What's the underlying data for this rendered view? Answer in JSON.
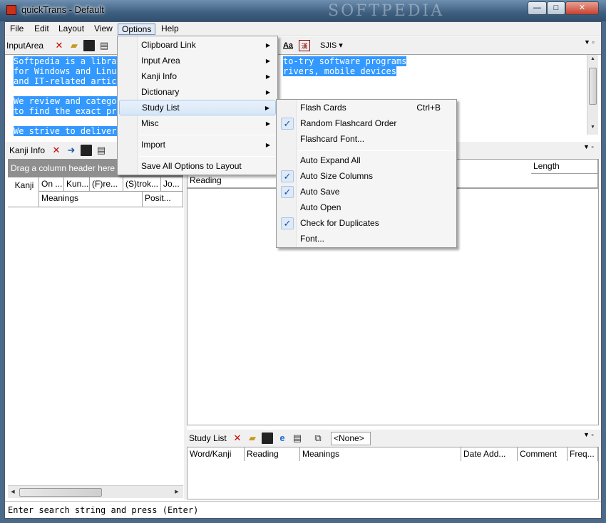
{
  "window": {
    "title": "quickTrans - Default",
    "watermark": "SOFTPEDIA",
    "buttons": {
      "minimize": "—",
      "maximize": "□",
      "close": "✕"
    }
  },
  "menubar": {
    "items": [
      "File",
      "Edit",
      "Layout",
      "View",
      "Options",
      "Help"
    ],
    "active": "Options"
  },
  "input_area": {
    "title": "InputArea",
    "encoding": "SJIS",
    "lines": [
      "Softpedia is a library of over 400,000 free and free-to-try software programs",
      "for Windows and Linux, games, Mac software, Windows drivers, mobile devices",
      "and IT-related articles.",
      "",
      "We review and categorize these products in order to allow the visitor/user",
      "to find the exact product they and their system needs.",
      "",
      "We strive to deliver only the best products to the visitor/user."
    ],
    "visible_fragments": {
      "line1_left": "Softpedia is a librar",
      "line1_right": "to-try software programs",
      "line2_left": "for Windows and Linux",
      "line2_right": "rivers, mobile devices",
      "line3_left": "and IT-related artic",
      "line5_left": "We review and categor",
      "line6_left": "to find the exact pro",
      "line8_left": "We strive to deliver "
    }
  },
  "kanji_info": {
    "title": "Kanji Info",
    "group_hint": "Drag a column header here",
    "columns_row1": [
      "Kanji",
      "On ...",
      "Kun...",
      "(F)re...",
      "(S)trok...",
      "Jo..."
    ],
    "columns_row2": [
      "Meanings",
      "Posit..."
    ]
  },
  "dictionary": {
    "columns": [
      "Length"
    ],
    "sub_columns": [
      "Reading"
    ]
  },
  "study_list": {
    "title": "Study List",
    "selector": "<None>",
    "columns": [
      "Word/Kanji",
      "Reading",
      "Meanings",
      "Date Add...",
      "Comment",
      "Freq..."
    ]
  },
  "status": {
    "prompt": "Enter search string and press (Enter)"
  },
  "options_menu": {
    "items": [
      {
        "label": "Clipboard Link",
        "submenu": true
      },
      {
        "label": "Input Area",
        "submenu": true
      },
      {
        "label": "Kanji Info",
        "submenu": true
      },
      {
        "label": "Dictionary",
        "submenu": true
      },
      {
        "label": "Study List",
        "submenu": true,
        "highlighted": true
      },
      {
        "label": "Misc",
        "submenu": true
      },
      {
        "label": "Import",
        "submenu": true
      },
      {
        "label": "Save All Options to Layout",
        "submenu": false
      }
    ]
  },
  "study_list_submenu": {
    "items": [
      {
        "label": "Flash Cards",
        "shortcut": "Ctrl+B",
        "checked": false
      },
      {
        "label": "Random Flashcard Order",
        "checked": true
      },
      {
        "label": "Flashcard Font...",
        "checked": false
      },
      {
        "label": "Auto Expand All",
        "checked": false
      },
      {
        "label": "Auto Size Columns",
        "checked": true
      },
      {
        "label": "Auto Save",
        "checked": true
      },
      {
        "label": "Auto Open",
        "checked": false
      },
      {
        "label": "Check for Duplicates",
        "checked": true
      },
      {
        "label": "Font...",
        "checked": false
      }
    ]
  },
  "icons": {
    "check": "✓",
    "submenu_arrow": "▶",
    "dropdown": "▾"
  },
  "colors": {
    "selection": "#3399ff",
    "check": "#1a4fa8"
  }
}
